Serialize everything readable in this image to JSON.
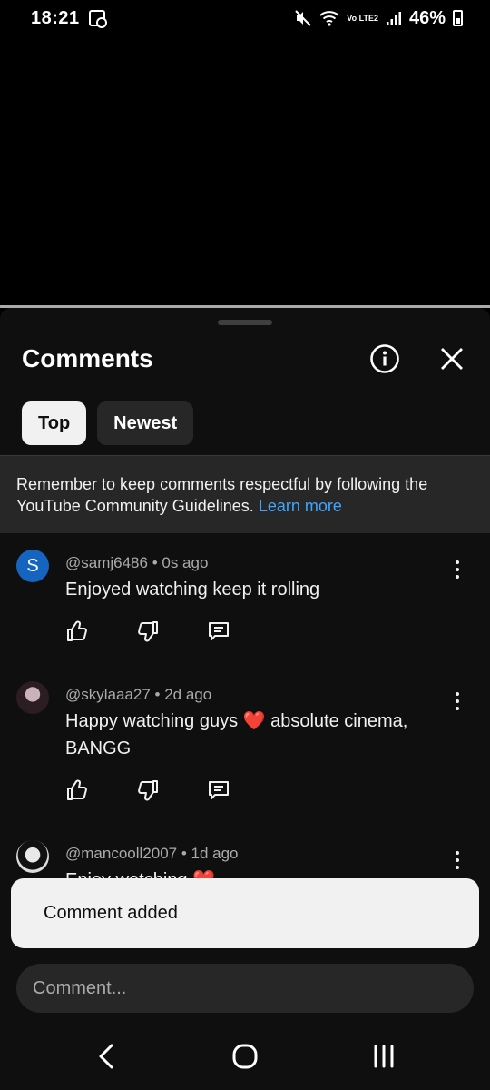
{
  "status_bar": {
    "time": "18:21",
    "network": "Vo LTE2",
    "battery_percent": "46%",
    "battery_level": 0.46
  },
  "sheet": {
    "title": "Comments",
    "tabs": [
      {
        "label": "Top",
        "active": true
      },
      {
        "label": "Newest",
        "active": false
      }
    ],
    "guidelines": {
      "text": "Remember to keep comments respectful by following the YouTube Community Guidelines.",
      "link": "Learn more"
    }
  },
  "comments": [
    {
      "author": "@samj6486",
      "time": "0s ago",
      "text": "Enjoyed watching keep it rolling",
      "avatar_letter": "S"
    },
    {
      "author": "@skylaaa27",
      "time": "2d ago",
      "text": "Happy watching guys ❤️ absolute cinema, BANGG"
    },
    {
      "author": "@mancooll2007",
      "time": "1d ago",
      "text": "Enjoy watching ❤️"
    }
  ],
  "snackbar": {
    "text": "Comment added"
  },
  "composer": {
    "placeholder": "Comment..."
  },
  "colors": {
    "accent_link": "#3ea6ff",
    "sheet_bg": "#0f0f0f",
    "chip_bg": "#272727"
  }
}
